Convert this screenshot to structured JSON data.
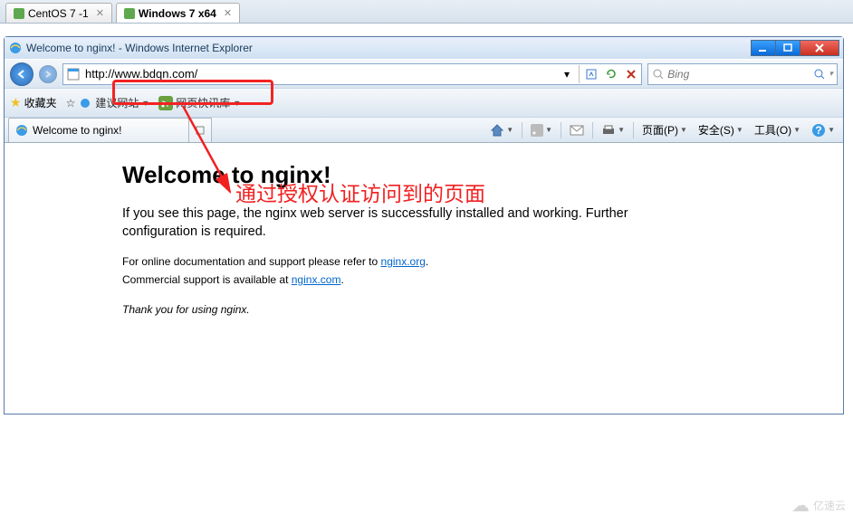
{
  "vm_tabs": {
    "items": [
      "CentOS 7 -1",
      "Windows 7 x64"
    ],
    "active": 1
  },
  "ie": {
    "title": "Welcome to nginx! - Windows Internet Explorer",
    "url": "http://www.bdqn.com/",
    "search_placeholder": "Bing",
    "favorites_label": "收藏夹",
    "suggested_sites_label": "建议网站",
    "web_slice_label": "网页快讯库",
    "page_tab_title": "Welcome to nginx!",
    "menu": {
      "page": "页面(P)",
      "safety": "安全(S)",
      "tools": "工具(O)"
    }
  },
  "page": {
    "h1": "Welcome to nginx!",
    "p1a": "If you see this page, the nginx web server is successfully installed and working. Further configuration is required.",
    "p2_pre": "For online documentation and support please refer to ",
    "p2_link1": "nginx.org",
    "p2_mid1": ".",
    "p2_br": "Commercial support is available at ",
    "p2_link2": "nginx.com",
    "p2_mid2": ".",
    "p3": "Thank you for using nginx."
  },
  "annotation": {
    "text": "通过授权认证访问到的页面"
  },
  "watermark": "亿速云"
}
